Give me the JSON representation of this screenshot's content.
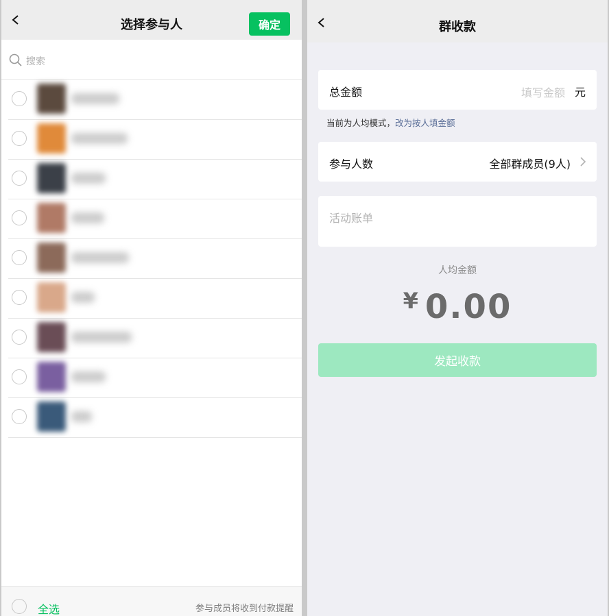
{
  "left": {
    "title": "选择参与人",
    "confirm_label": "确定",
    "search_placeholder": "搜索",
    "members_count": 9,
    "avatar_colors": [
      "#5b4a3e",
      "#e08a3a",
      "#3b4048",
      "#b07a66",
      "#8c6a5a",
      "#d9a88a",
      "#6a4d56",
      "#7a5fa0",
      "#3a5a7a"
    ],
    "select_all_label": "全选",
    "footer_note": "参与成员将收到付款提醒"
  },
  "right": {
    "title": "群收款",
    "total_label": "总金额",
    "amount_placeholder": "填写金额",
    "currency_unit": "元",
    "mode_note": "当前为人均模式，",
    "mode_link": "改为按人填金额",
    "participants_label": "参与人数",
    "participants_value": "全部群成员(9人)",
    "bill_placeholder": "活动账单",
    "per_person_label": "人均金额",
    "currency_symbol": "¥",
    "per_person_amount": "0.00",
    "launch_button": "发起收款"
  },
  "colors": {
    "accent_green": "#07c160",
    "disabled_green": "#9de8c0",
    "link_blue": "#576b95"
  }
}
